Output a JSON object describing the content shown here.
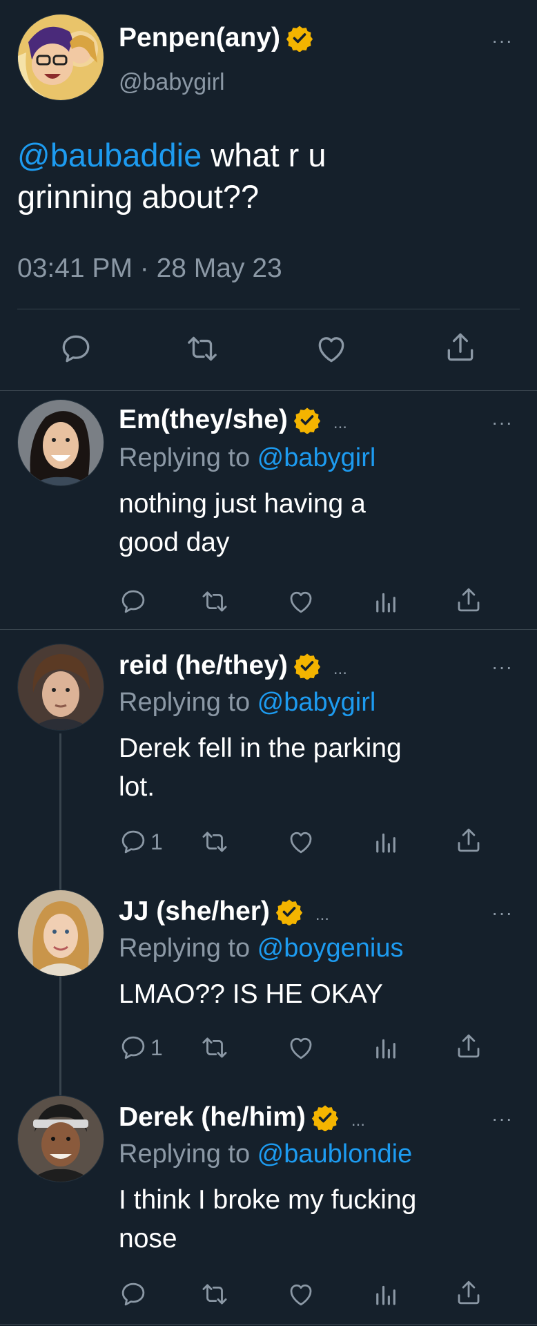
{
  "main_tweet": {
    "display_name": "Penpen(any)",
    "handle": "@babygirl",
    "mention": "@baubaddie",
    "text_line1": " what r u",
    "text_line2": "grinning about??",
    "timestamp": "03:41 PM · 28 May 23",
    "more": "···"
  },
  "replies": [
    {
      "display_name": "Em(they/she)",
      "ellipsis": "...",
      "replying_prefix": "Replying to ",
      "replying_handle": "@babygirl",
      "text_line1": "nothing just having a",
      "text_line2": "good day",
      "reply_count": "",
      "more": "···"
    },
    {
      "display_name": "reid (he/they)",
      "ellipsis": "...",
      "replying_prefix": "Replying to ",
      "replying_handle": "@babygirl",
      "text_line1": "Derek fell in the parking",
      "text_line2": "lot.",
      "reply_count": "1",
      "more": "···"
    },
    {
      "display_name": "JJ (she/her)",
      "ellipsis": "...",
      "replying_prefix": "Replying to ",
      "replying_handle": "@boygenius",
      "text_line1": "LMAO?? IS HE OKAY",
      "text_line2": "",
      "reply_count": "1",
      "more": "···"
    },
    {
      "display_name": "Derek (he/him)",
      "ellipsis": "...",
      "replying_prefix": "Replying to ",
      "replying_handle": "@baublondie",
      "text_line1": "I think I broke my fucking",
      "text_line2": "nose",
      "reply_count": "",
      "more": "···"
    }
  ],
  "colors": {
    "background": "#15202b",
    "link": "#1d9bf0",
    "muted": "#8b98a5",
    "verified": "#f4b400",
    "divider": "#38444d"
  },
  "icons": [
    "reply-icon",
    "retweet-icon",
    "like-icon",
    "views-icon",
    "share-icon",
    "verified-badge-icon",
    "more-icon"
  ]
}
